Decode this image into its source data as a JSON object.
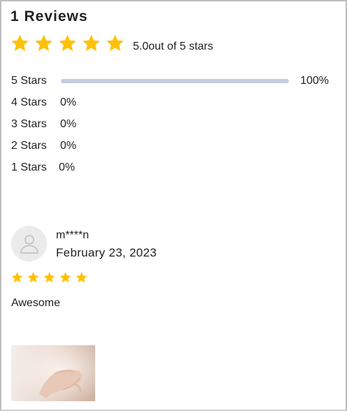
{
  "header": {
    "title": "1 Reviews"
  },
  "summary": {
    "rating": 5,
    "max_rating": 5,
    "star_icon": "star-icon",
    "star_color": "#FFC107",
    "average_text": "5.0out of 5 stars"
  },
  "distribution": [
    {
      "label": "5 Stars",
      "percent_text": "100%",
      "fraction": 1.0
    },
    {
      "label": "4 Stars",
      "percent_text": "0%",
      "fraction": 0.0
    },
    {
      "label": "3 Stars",
      "percent_text": "0%",
      "fraction": 0.0
    },
    {
      "label": "2 Stars",
      "percent_text": "0%",
      "fraction": 0.0
    },
    {
      "label": "1 Stars",
      "percent_text": "0%",
      "fraction": 0.0
    }
  ],
  "bar_color": "#C5CBE3",
  "review": {
    "author": "m****n",
    "date": "February 23, 2023",
    "rating": 5,
    "text": "Awesome",
    "avatar_icon": "user-placeholder-icon",
    "photo": "hand-photo"
  }
}
